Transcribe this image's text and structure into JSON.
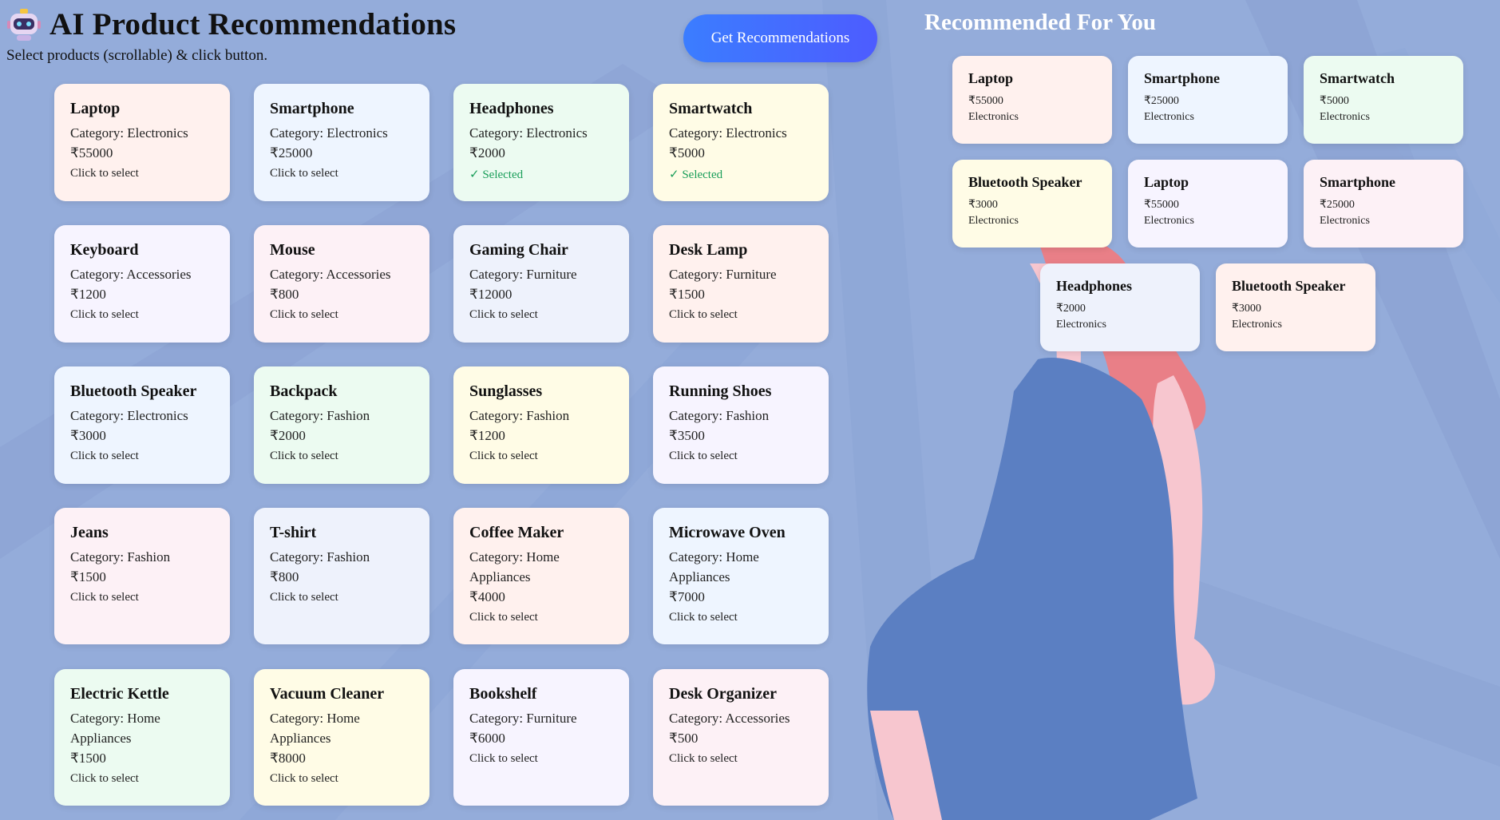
{
  "header": {
    "title": "AI Product Recommendations",
    "subtitle": "Select products (scrollable) & click button.",
    "button_label": "Get Recommendations"
  },
  "products": [
    {
      "name": "Laptop",
      "category": "Category: Electronics",
      "price": "₹55000",
      "status": "Click to select",
      "selected": false,
      "color": "#fff1ee"
    },
    {
      "name": "Smartphone",
      "category": "Category: Electronics",
      "price": "₹25000",
      "status": "Click to select",
      "selected": false,
      "color": "#eef5ff"
    },
    {
      "name": "Headphones",
      "category": "Category: Electronics",
      "price": "₹2000",
      "status": "✓ Selected",
      "selected": true,
      "color": "#ecfbf1"
    },
    {
      "name": "Smartwatch",
      "category": "Category: Electronics",
      "price": "₹5000",
      "status": "✓ Selected",
      "selected": true,
      "color": "#fffce6"
    },
    {
      "name": "Keyboard",
      "category": "Category: Accessories",
      "price": "₹1200",
      "status": "Click to select",
      "selected": false,
      "color": "#f7f4ff"
    },
    {
      "name": "Mouse",
      "category": "Category: Accessories",
      "price": "₹800",
      "status": "Click to select",
      "selected": false,
      "color": "#fdf1f6"
    },
    {
      "name": "Gaming Chair",
      "category": "Category: Furniture",
      "price": "₹12000",
      "status": "Click to select",
      "selected": false,
      "color": "#eef2fc"
    },
    {
      "name": "Desk Lamp",
      "category": "Category: Furniture",
      "price": "₹1500",
      "status": "Click to select",
      "selected": false,
      "color": "#fff1ee"
    },
    {
      "name": "Bluetooth Speaker",
      "category": "Category: Electronics",
      "price": "₹3000",
      "status": "Click to select",
      "selected": false,
      "color": "#eef5ff"
    },
    {
      "name": "Backpack",
      "category": "Category: Fashion",
      "price": "₹2000",
      "status": "Click to select",
      "selected": false,
      "color": "#ecfbf1"
    },
    {
      "name": "Sunglasses",
      "category": "Category: Fashion",
      "price": "₹1200",
      "status": "Click to select",
      "selected": false,
      "color": "#fffce6"
    },
    {
      "name": "Running Shoes",
      "category": "Category: Fashion",
      "price": "₹3500",
      "status": "Click to select",
      "selected": false,
      "color": "#f7f4ff"
    },
    {
      "name": "Jeans",
      "category": "Category: Fashion",
      "price": "₹1500",
      "status": "Click to select",
      "selected": false,
      "color": "#fdf1f6"
    },
    {
      "name": "T-shirt",
      "category": "Category: Fashion",
      "price": "₹800",
      "status": "Click to select",
      "selected": false,
      "color": "#eef2fc"
    },
    {
      "name": "Coffee Maker",
      "category": "Category: Home Appliances",
      "price": "₹4000",
      "status": "Click to select",
      "selected": false,
      "color": "#fff1ee"
    },
    {
      "name": "Microwave Oven",
      "category": "Category: Home Appliances",
      "price": "₹7000",
      "status": "Click to select",
      "selected": false,
      "color": "#eef5ff"
    },
    {
      "name": "Electric Kettle",
      "category": "Category: Home Appliances",
      "price": "₹1500",
      "status": "Click to select",
      "selected": false,
      "color": "#ecfbf1"
    },
    {
      "name": "Vacuum Cleaner",
      "category": "Category: Home Appliances",
      "price": "₹8000",
      "status": "Click to select",
      "selected": false,
      "color": "#fffce6"
    },
    {
      "name": "Bookshelf",
      "category": "Category: Furniture",
      "price": "₹6000",
      "status": "Click to select",
      "selected": false,
      "color": "#f7f4ff"
    },
    {
      "name": "Desk Organizer",
      "category": "Category: Accessories",
      "price": "₹500",
      "status": "Click to select",
      "selected": false,
      "color": "#fdf1f6"
    }
  ],
  "recommendations": {
    "title": "Recommended For You",
    "items": [
      {
        "name": "Laptop",
        "price": "₹55000",
        "category": "Electronics",
        "color": "#fff1ee"
      },
      {
        "name": "Smartphone",
        "price": "₹25000",
        "category": "Electronics",
        "color": "#eef5ff"
      },
      {
        "name": "Smartwatch",
        "price": "₹5000",
        "category": "Electronics",
        "color": "#ecfbf1"
      },
      {
        "name": "Bluetooth Speaker",
        "price": "₹3000",
        "category": "Electronics",
        "color": "#fffce6"
      },
      {
        "name": "Laptop",
        "price": "₹55000",
        "category": "Electronics",
        "color": "#f7f4ff"
      },
      {
        "name": "Smartphone",
        "price": "₹25000",
        "category": "Electronics",
        "color": "#fdf1f6"
      },
      {
        "name": "Headphones",
        "price": "₹2000",
        "category": "Electronics",
        "color": "#eef2fc"
      },
      {
        "name": "Bluetooth Speaker",
        "price": "₹3000",
        "category": "Electronics",
        "color": "#fff1ee"
      }
    ]
  }
}
